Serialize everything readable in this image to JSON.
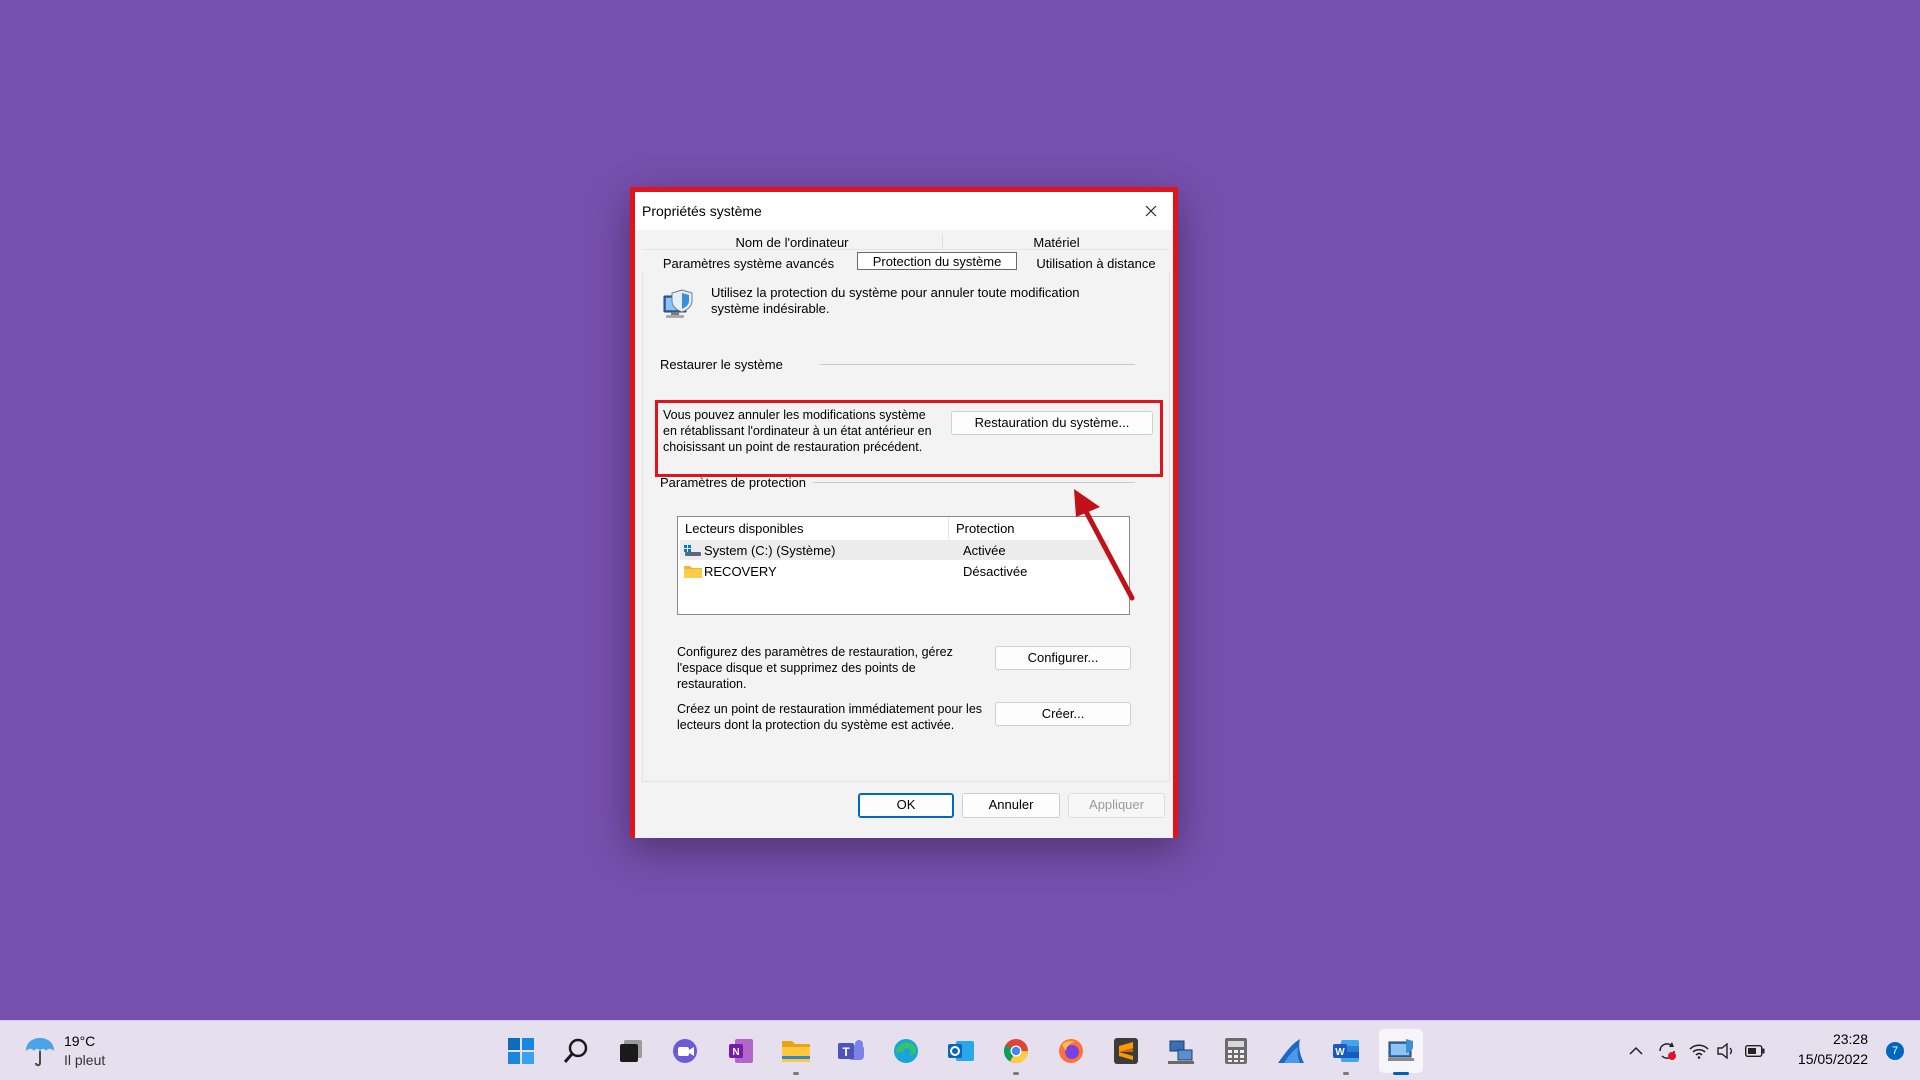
{
  "dialog": {
    "title": "Propriétés système",
    "tabs_row1": [
      "Nom de l'ordinateur",
      "Matériel"
    ],
    "tabs_row2": [
      "Paramètres système avancés",
      "Protection du système",
      "Utilisation à distance"
    ],
    "active_tab": "Protection du système",
    "intro_text": "Utilisez la protection du système pour annuler toute modification système indésirable.",
    "restore_group": "Restaurer le système",
    "restore_text": "Vous pouvez annuler les modifications système en rétablissant l'ordinateur à un état antérieur en choisissant un point de restauration précédent.",
    "restore_button": "Restauration du système...",
    "protection_group": "Paramètres de protection",
    "list": {
      "columns": [
        "Lecteurs disponibles",
        "Protection"
      ],
      "rows": [
        {
          "drive": "System (C:) (Système)",
          "protection": "Activée",
          "icon": "drive-icon"
        },
        {
          "drive": "RECOVERY",
          "protection": "Désactivée",
          "icon": "folder-icon"
        }
      ]
    },
    "configure_text": "Configurez des paramètres de restauration, gérez l'espace disque et supprimez des points de restauration.",
    "configure_button": "Configurer...",
    "create_text": "Créez un point de restauration immédiatement pour les lecteurs dont la protection du système est activée.",
    "create_button": "Créer...",
    "ok_button": "OK",
    "cancel_button": "Annuler",
    "apply_button": "Appliquer"
  },
  "taskbar": {
    "weather_temp": "19°C",
    "weather_condition": "Il pleut",
    "apps": [
      "start",
      "search",
      "task-view",
      "chat",
      "onenote",
      "file-explorer",
      "teams",
      "edge",
      "outlook",
      "chrome",
      "firefox",
      "sublime-text",
      "network",
      "calculator",
      "app-shark",
      "word",
      "system-properties"
    ],
    "time": "23:28",
    "date": "15/05/2022",
    "notifications": "7"
  },
  "colors": {
    "desktop": "#774fad",
    "highlight": "#e0141c",
    "accent": "#0067c0"
  }
}
